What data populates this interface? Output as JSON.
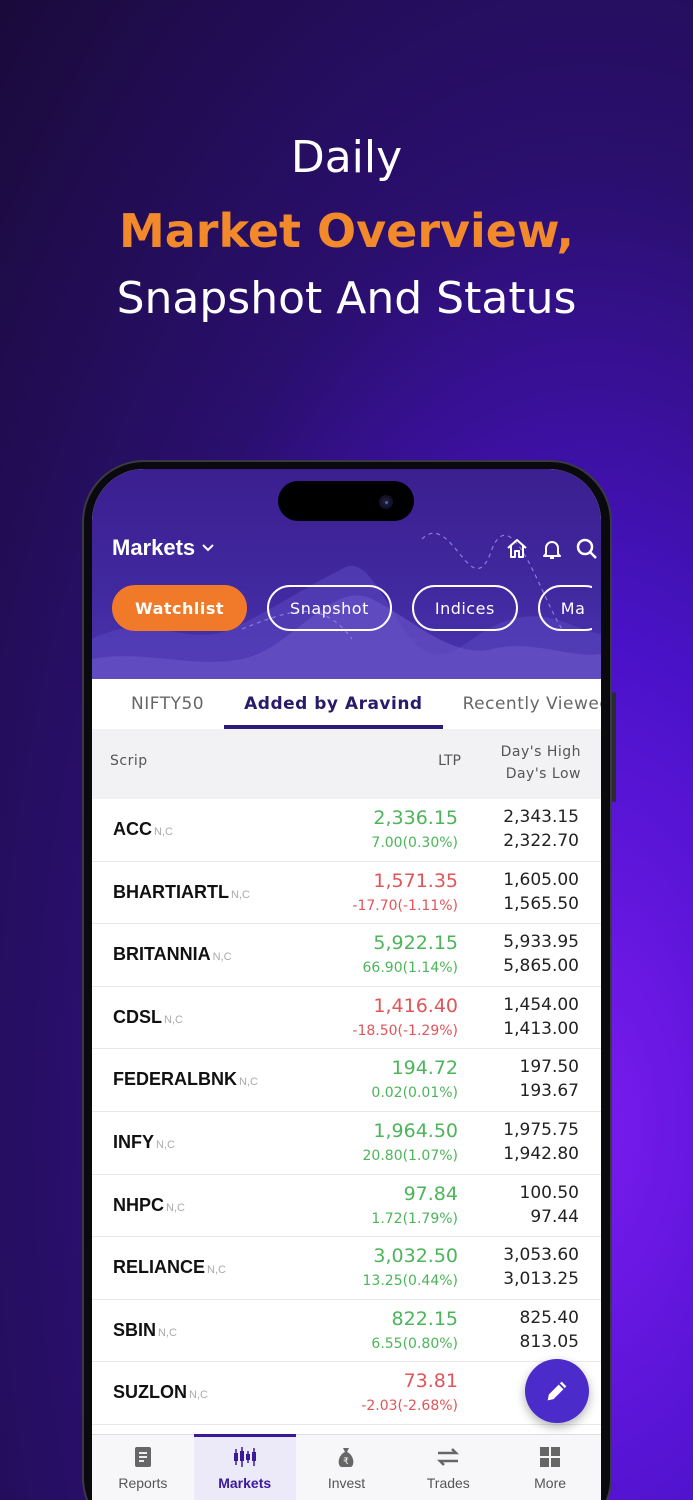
{
  "promo": {
    "line1": "Daily",
    "line2": "Market Overview,",
    "line3": "Snapshot And Status"
  },
  "header": {
    "title": "Markets",
    "icons": [
      "home-icon",
      "bell-icon",
      "search-icon"
    ],
    "pills": [
      {
        "label": "Watchlist",
        "active": true
      },
      {
        "label": "Snapshot"
      },
      {
        "label": "Indices"
      },
      {
        "label": "Ma"
      }
    ]
  },
  "subtabs": [
    {
      "label": "NIFTY50"
    },
    {
      "label": "Added by Aravind",
      "active": true
    },
    {
      "label": "Recently Viewed"
    }
  ],
  "table": {
    "col_scrip": "Scrip",
    "col_ltp": "LTP",
    "col_high": "Day's High",
    "col_low": "Day's Low",
    "rows": [
      {
        "symbol": "ACC",
        "tag": "N,C",
        "ltp": "2,336.15",
        "change": "7.00(0.30%)",
        "dir": "up",
        "high": "2,343.15",
        "low": "2,322.70"
      },
      {
        "symbol": "BHARTIARTL",
        "tag": "N,C",
        "ltp": "1,571.35",
        "change": "-17.70(-1.11%)",
        "dir": "dn",
        "high": "1,605.00",
        "low": "1,565.50"
      },
      {
        "symbol": "BRITANNIA",
        "tag": "N,C",
        "ltp": "5,922.15",
        "change": "66.90(1.14%)",
        "dir": "up",
        "high": "5,933.95",
        "low": "5,865.00"
      },
      {
        "symbol": "CDSL",
        "tag": "N,C",
        "ltp": "1,416.40",
        "change": "-18.50(-1.29%)",
        "dir": "dn",
        "high": "1,454.00",
        "low": "1,413.00"
      },
      {
        "symbol": "FEDERALBNK",
        "tag": "N,C",
        "ltp": "194.72",
        "change": "0.02(0.01%)",
        "dir": "up",
        "high": "197.50",
        "low": "193.67"
      },
      {
        "symbol": "INFY",
        "tag": "N,C",
        "ltp": "1,964.50",
        "change": "20.80(1.07%)",
        "dir": "up",
        "high": "1,975.75",
        "low": "1,942.80"
      },
      {
        "symbol": "NHPC",
        "tag": "N,C",
        "ltp": "97.84",
        "change": "1.72(1.79%)",
        "dir": "up",
        "high": "100.50",
        "low": "97.44"
      },
      {
        "symbol": "RELIANCE",
        "tag": "N,C",
        "ltp": "3,032.50",
        "change": "13.25(0.44%)",
        "dir": "up",
        "high": "3,053.60",
        "low": "3,013.25"
      },
      {
        "symbol": "SBIN",
        "tag": "N,C",
        "ltp": "822.15",
        "change": "6.55(0.80%)",
        "dir": "up",
        "high": "825.40",
        "low": "813.05"
      },
      {
        "symbol": "SUZLON",
        "tag": "N,C",
        "ltp": "73.81",
        "change": "-2.03(-2.68%)",
        "dir": "dn",
        "high": "",
        "low": ""
      }
    ]
  },
  "bottom_nav": [
    {
      "label": "Reports",
      "icon": "reports-icon"
    },
    {
      "label": "Markets",
      "icon": "markets-icon",
      "active": true
    },
    {
      "label": "Invest",
      "icon": "invest-icon"
    },
    {
      "label": "Trades",
      "icon": "trades-icon"
    },
    {
      "label": "More",
      "icon": "more-grid-icon"
    }
  ],
  "colors": {
    "accent": "#f07a2a",
    "brand": "#3b1f90",
    "up": "#4cb55a",
    "down": "#e0555a"
  }
}
